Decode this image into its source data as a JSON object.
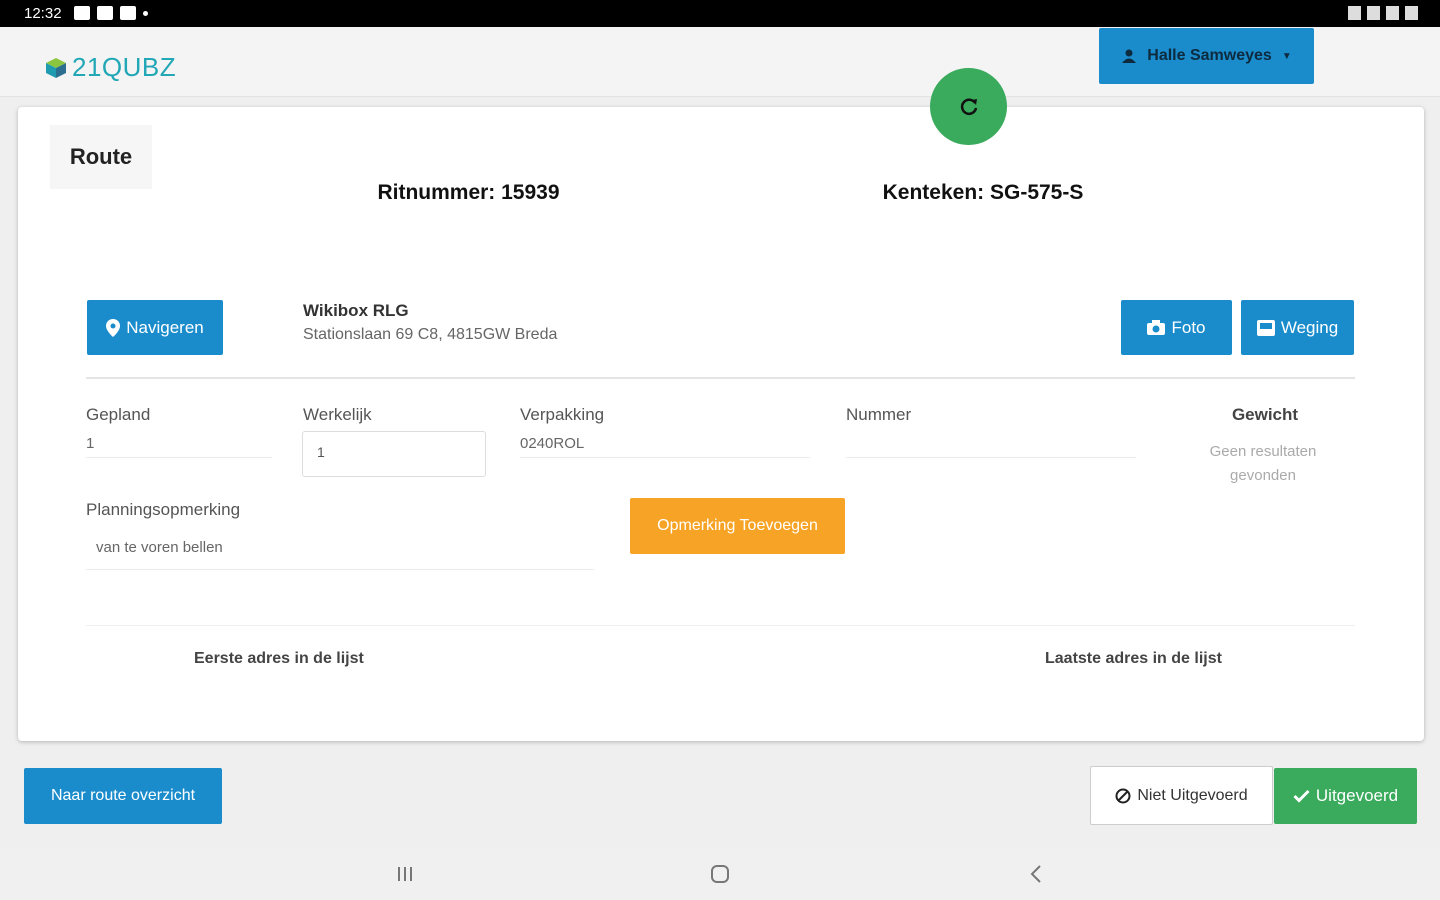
{
  "statusbar": {
    "time": "12:32"
  },
  "header": {
    "logo_text": "21QUBZ",
    "user_name": "Halle Samweyes"
  },
  "colors": {
    "primary": "#1a8ccc",
    "success": "#3aaa5c",
    "warning": "#f7a325"
  },
  "card": {
    "title": "Route",
    "ritnummer": "Ritnummer: 15939",
    "kenteken": "Kenteken: SG-575-S",
    "navigate_label": "Navigeren",
    "location_name": "Wikibox RLG",
    "location_address": "Stationslaan 69 C8, 4815GW Breda",
    "foto_label": "Foto",
    "weging_label": "Weging",
    "gepland_label": "Gepland",
    "gepland_value": "1",
    "werkelijk_label": "Werkelijk",
    "werkelijk_value": "1",
    "verpakking_label": "Verpakking",
    "verpakking_value": "0240ROL",
    "nummer_label": "Nummer",
    "gewicht_label": "Gewicht",
    "gewicht_empty": "Geen resultaten gevonden",
    "planning_label": "Planningsopmerking",
    "planning_value": "van te voren bellen",
    "opmerking_button": "Opmerking Toevoegen",
    "first_address": "Eerste adres in de lijst",
    "last_address": "Laatste adres in de lijst"
  },
  "footer": {
    "overview_button": "Naar route overzicht",
    "not_done_button": "Niet Uitgevoerd",
    "done_button": "Uitgevoerd"
  }
}
